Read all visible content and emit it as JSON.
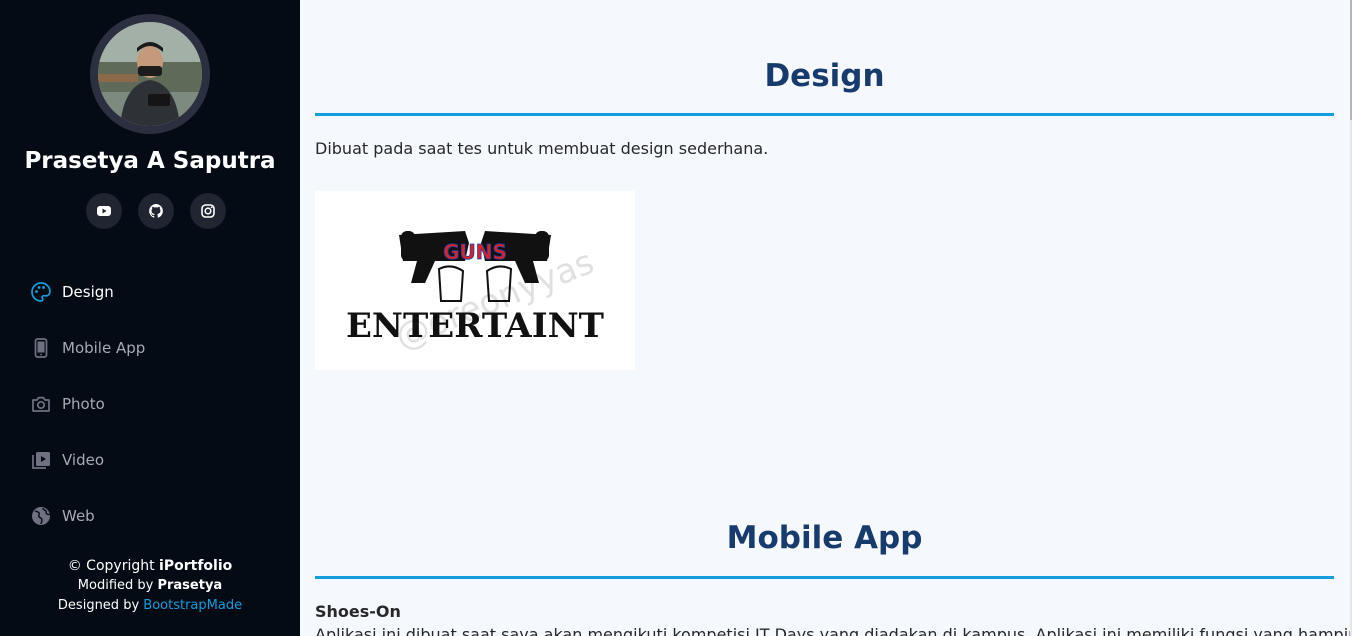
{
  "sidebar": {
    "profile_name": "Prasetya A Saputra",
    "social": [
      {
        "name": "youtube-icon"
      },
      {
        "name": "github-icon"
      },
      {
        "name": "instagram-icon"
      }
    ],
    "nav": [
      {
        "label": "Design",
        "icon": "palette-icon",
        "active": true
      },
      {
        "label": "Mobile App",
        "icon": "phone-icon",
        "active": false
      },
      {
        "label": "Photo",
        "icon": "camera-icon",
        "active": false
      },
      {
        "label": "Video",
        "icon": "video-icon",
        "active": false
      },
      {
        "label": "Web",
        "icon": "globe-icon",
        "active": false
      }
    ],
    "footer": {
      "copyright_prefix": "© Copyright ",
      "copyright_brand": "iPortfolio",
      "modified_prefix": "Modified by ",
      "modified_name": "Prasetya",
      "designed_prefix": "Designed by ",
      "designed_link": "BootstrapMade"
    }
  },
  "main": {
    "design": {
      "title": "Design",
      "description": "Dibuat pada saat tes untuk membuat design sederhana.",
      "image_text_top": "GUNS",
      "image_text_bottom": "ENTERTAINT",
      "image_watermark": "@oreonyyas"
    },
    "mobile_app": {
      "title": "Mobile App",
      "subtitle": "Shoes-On",
      "description": "Aplikasi ini dibuat saat saya akan mengikuti kompetisi IT Days yang diadakan di kampus. Aplikasi ini memiliki fungsi yang hampir sama"
    }
  },
  "colors": {
    "sidebar_bg": "#040b14",
    "accent": "#149ddd",
    "title": "#173b6c",
    "main_bg": "#f5f8fd",
    "nav_muted": "#a8a9b4"
  }
}
